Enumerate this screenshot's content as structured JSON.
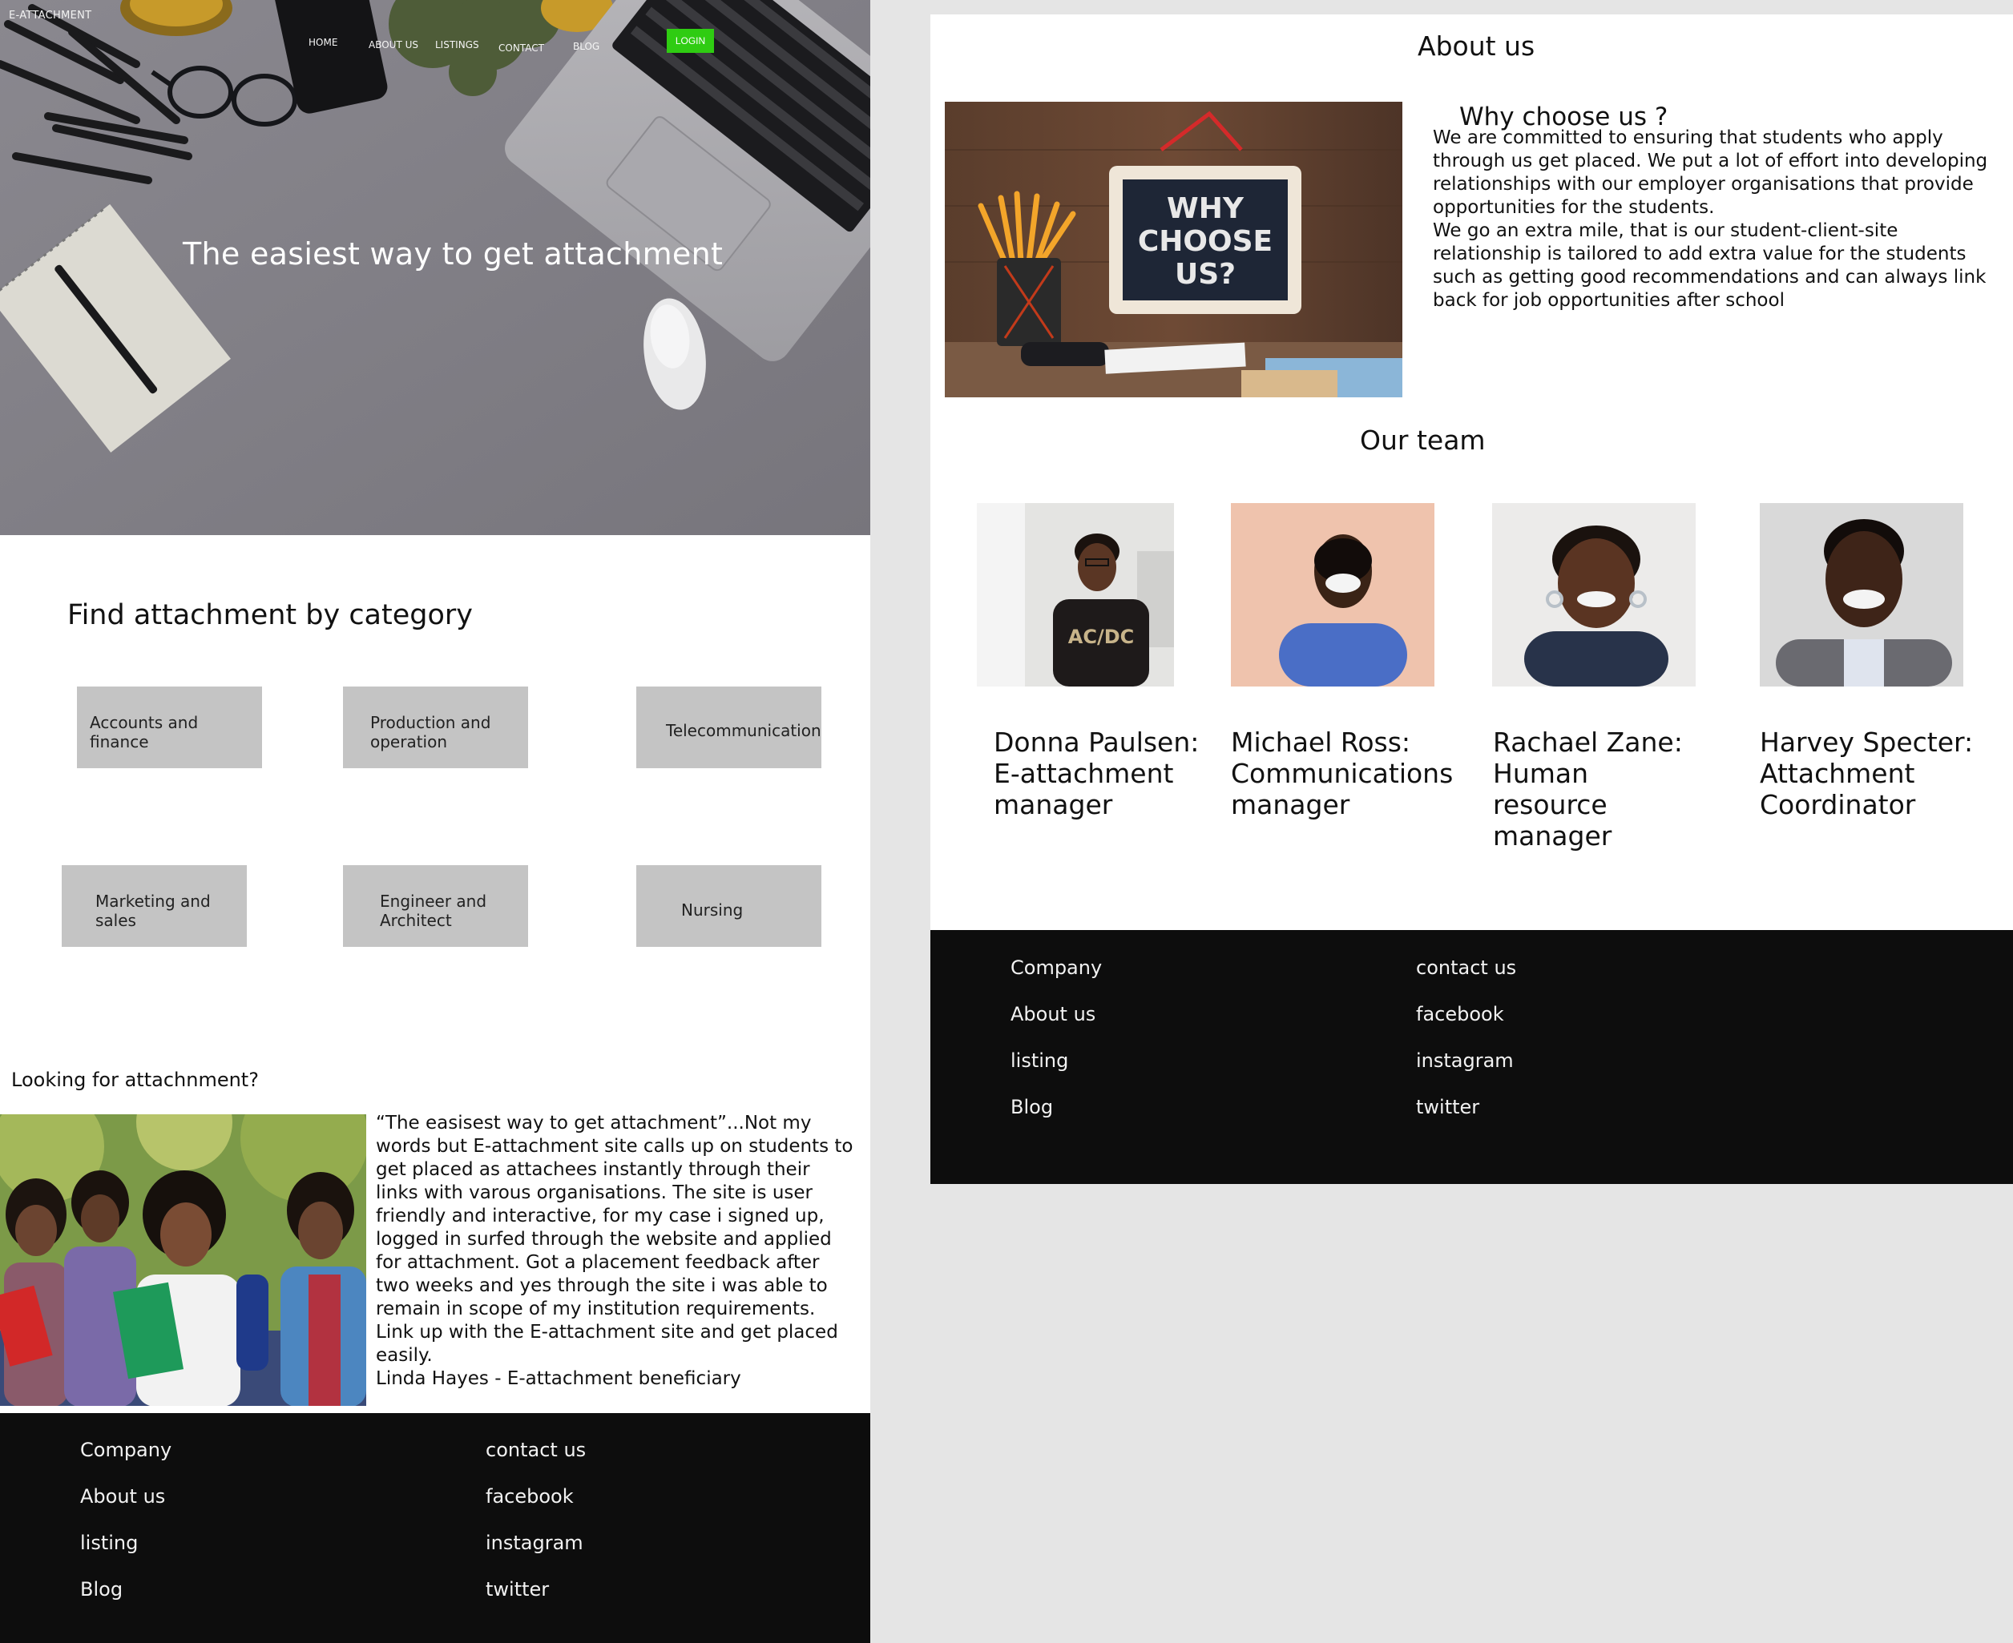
{
  "brand": "E-ATTACHMENT",
  "nav": {
    "home": "HOME",
    "about": "ABOUT US",
    "listings": "LISTINGS",
    "contact": "CONTACT",
    "blog": "BLOG",
    "login": "LOGIN"
  },
  "hero": {
    "title": "The easiest way to get attachment"
  },
  "categories": {
    "title": "Find  attachment  by  category",
    "items": [
      "Accounts and finance",
      "Production and operation",
      "Telecommunication",
      "Marketing and sales",
      "Engineer and Architect",
      "Nursing"
    ]
  },
  "testimonial": {
    "heading": "Looking for attachnment?",
    "quote": "“The  easisest  way  to  get  attachment”...Not  my words but E-attachment  site calls up  on  students to  get  placed as attachees  instantly  through  their  links with  varous  organisations. The  site  is  user  friendly and  interactive, for my  case i signed up, logged in surfed  through  the  website and applied for  attachment. Got  a placement  feedback  after two  weeks  and  yes through  the site  i  was  able  to  remain  in  scope  of  my  institution requirements. Link  up  with  the  E-attachment site and  get  placed easily.",
    "author": "Linda Hayes - E-attachment beneficiary"
  },
  "footer": {
    "company": "Company",
    "about": "About us",
    "listing": "listing",
    "blog": "Blog",
    "contact": "contact us",
    "facebook": "facebook",
    "instagram": "instagram",
    "twitter": "twitter"
  },
  "about": {
    "title": "About us",
    "why_heading": "Why choose  us ?",
    "chalk_line1": "WHY",
    "chalk_line2": "CHOOSE",
    "chalk_line3": "US?",
    "paragraph1": "We are  committed  to  ensuring that  students who  apply through  us get placed. We put  a lot  of  effort into developing relationships with our employer organisations that provide opportunities for  the  students.",
    "paragraph2": "We  go  an extra mile, that is our student-client-site relationship is  tailored to add extra value for  the  students such as getting  good recommendations and  can  always link back for  job opportunities after school"
  },
  "team": {
    "title": "Our team",
    "members": [
      {
        "name": "Donna  Paulsen:",
        "role": "E-attachment manager"
      },
      {
        "name": "Michael Ross:",
        "role": "Communications manager"
      },
      {
        "name": "Rachael Zane:",
        "role": "Human resource manager"
      },
      {
        "name": "Harvey Specter:",
        "role": "Attachment Coordinator"
      }
    ]
  }
}
